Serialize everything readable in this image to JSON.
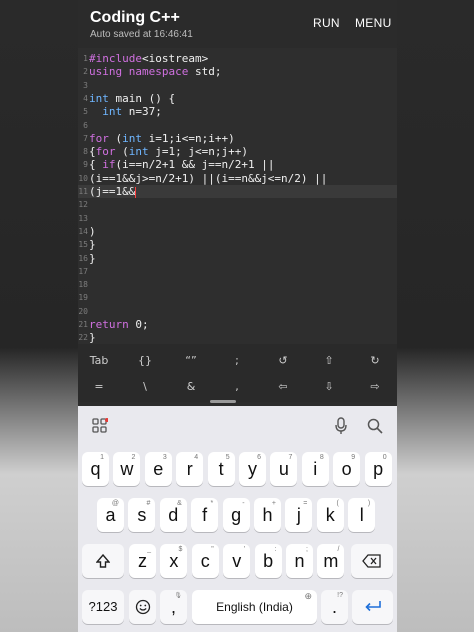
{
  "app": {
    "title": "Coding C++",
    "subtitle": "Auto saved at 16:46:41",
    "run_label": "RUN",
    "menu_label": "MENU"
  },
  "editor": {
    "lines": [
      {
        "n": "1",
        "text": "#include<iostream>"
      },
      {
        "n": "2",
        "text": "using namespace std;"
      },
      {
        "n": "3",
        "text": ""
      },
      {
        "n": "4",
        "text": "int main () {"
      },
      {
        "n": "5",
        "text": "  int n=37;"
      },
      {
        "n": "6",
        "text": ""
      },
      {
        "n": "7",
        "text": "for (int i=1;i<=n;i++)"
      },
      {
        "n": "8",
        "text": "{for (int j=1; j<=n;j++)"
      },
      {
        "n": "9",
        "text": "{ if(i==n/2+1 && j==n/2+1 ||"
      },
      {
        "n": "10",
        "text": "(i==1&&j>=n/2+1) ||(i==n&&j<=n/2) ||"
      },
      {
        "n": "11",
        "text": "(j==1&&"
      },
      {
        "n": "12",
        "text": ""
      },
      {
        "n": "13",
        "text": ""
      },
      {
        "n": "14",
        "text": ")"
      },
      {
        "n": "15",
        "text": "}"
      },
      {
        "n": "16",
        "text": "}"
      },
      {
        "n": "17",
        "text": ""
      },
      {
        "n": "18",
        "text": ""
      },
      {
        "n": "19",
        "text": ""
      },
      {
        "n": "20",
        "text": ""
      },
      {
        "n": "21",
        "text": "return 0;"
      },
      {
        "n": "22",
        "text": "}"
      }
    ]
  },
  "symbols": {
    "row1": [
      "Tab",
      "{}",
      "“”",
      ";",
      "↺",
      "⇧",
      "↻"
    ],
    "row2": [
      "=",
      "\\",
      "&",
      ",",
      "⇦",
      "⇩",
      "⇨"
    ]
  },
  "keyboard": {
    "row1": [
      {
        "k": "q",
        "s": "1"
      },
      {
        "k": "w",
        "s": "2"
      },
      {
        "k": "e",
        "s": "3"
      },
      {
        "k": "r",
        "s": "4"
      },
      {
        "k": "t",
        "s": "5"
      },
      {
        "k": "y",
        "s": "6"
      },
      {
        "k": "u",
        "s": "7"
      },
      {
        "k": "i",
        "s": "8"
      },
      {
        "k": "o",
        "s": "9"
      },
      {
        "k": "p",
        "s": "0"
      }
    ],
    "row2": [
      {
        "k": "a",
        "s": "@"
      },
      {
        "k": "s",
        "s": "#"
      },
      {
        "k": "d",
        "s": "&"
      },
      {
        "k": "f",
        "s": "*"
      },
      {
        "k": "g",
        "s": "-"
      },
      {
        "k": "h",
        "s": "+"
      },
      {
        "k": "j",
        "s": "="
      },
      {
        "k": "k",
        "s": "("
      },
      {
        "k": "l",
        "s": ")"
      }
    ],
    "row3": [
      {
        "k": "z",
        "s": "_"
      },
      {
        "k": "x",
        "s": "$"
      },
      {
        "k": "c",
        "s": "\""
      },
      {
        "k": "v",
        "s": "'"
      },
      {
        "k": "b",
        "s": ":"
      },
      {
        "k": "n",
        "s": ";"
      },
      {
        "k": "m",
        "s": "/"
      }
    ],
    "numbers_label": "?123",
    "space_label": "English (India)",
    "period_label": ".",
    "period_sup": "!?",
    "comma_label": ","
  }
}
